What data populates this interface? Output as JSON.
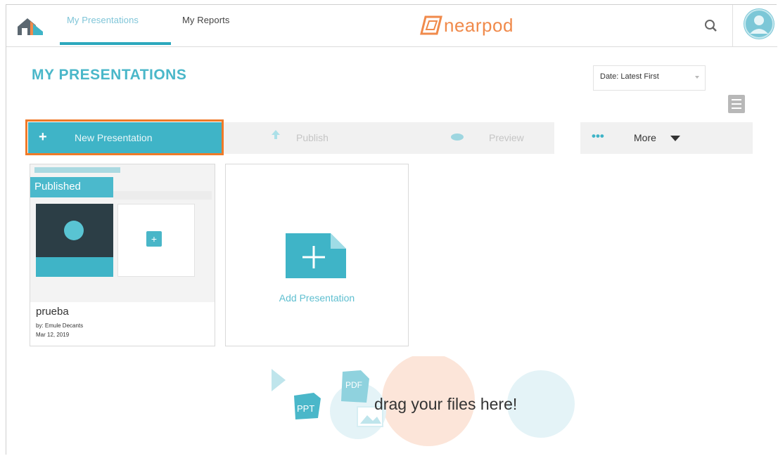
{
  "nav": {
    "tabs": [
      {
        "label": "My Presentations",
        "active": true
      },
      {
        "label": "My Reports",
        "active": false
      }
    ],
    "logo_text": "nearpod",
    "brand_color": "#f08a4b",
    "accent_color": "#3fb4c7"
  },
  "header": {
    "title": "MY PRESENTATIONS",
    "sort_selected": "Date: Latest First"
  },
  "toolbar": {
    "new_label": "New Presentation",
    "publish_label": "Publish",
    "preview_label": "Preview",
    "more_label": "More",
    "highlight_color": "#f07a28"
  },
  "cards": [
    {
      "badge": "Published",
      "title": "prueba",
      "author": "by: Emule Decants",
      "date": "Mar 12, 2019"
    }
  ],
  "add_card": {
    "label": "Add Presentation"
  },
  "dropzone": {
    "text": "drag your files here!",
    "ppt_label": "PPT",
    "pdf_label": "PDF"
  }
}
